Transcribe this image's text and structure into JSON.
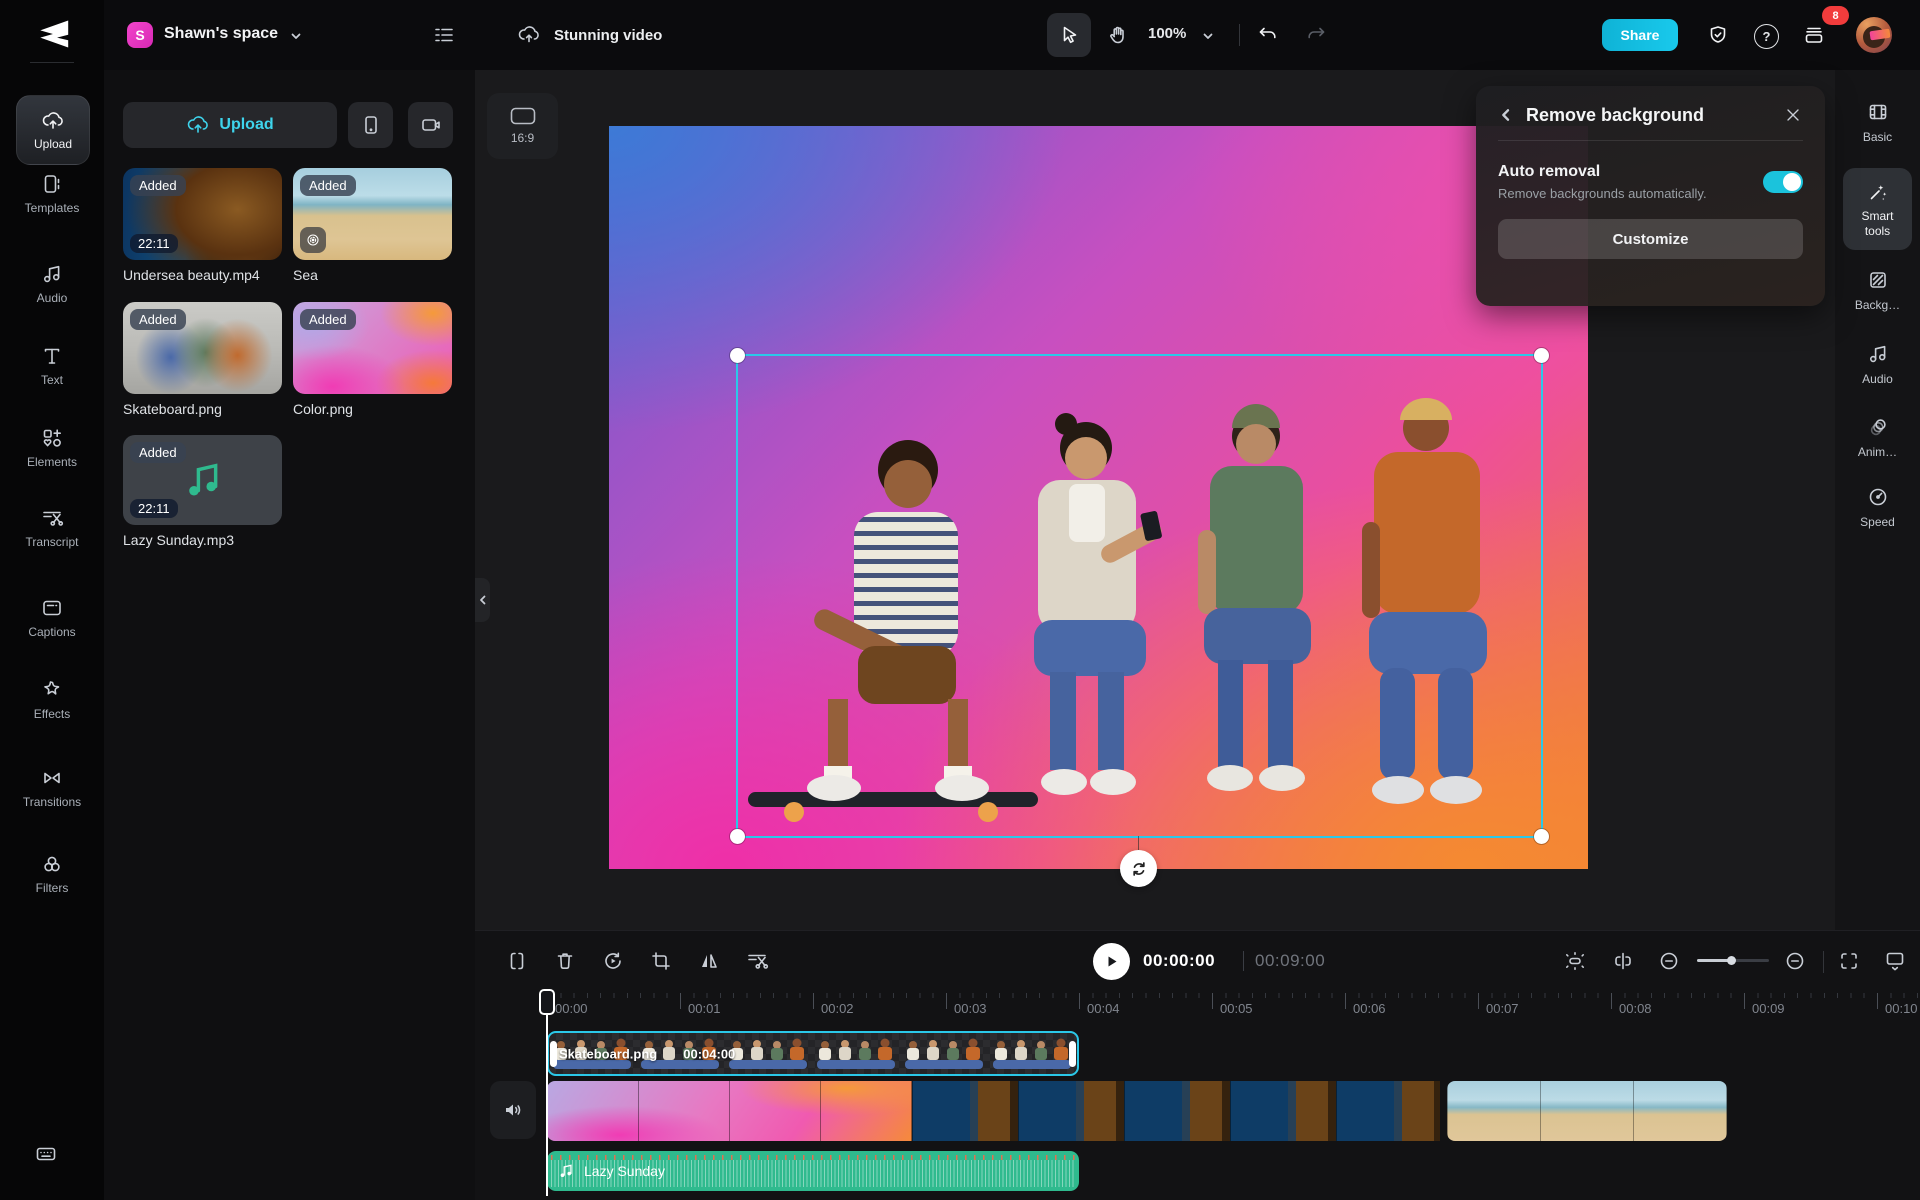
{
  "topbar": {
    "workspace_initial": "S",
    "workspace_name": "Shawn's space",
    "project_title": "Stunning video",
    "zoom_level": "100%",
    "share_label": "Share",
    "notification_count": "8",
    "help_glyph": "?"
  },
  "sidebar": {
    "items": [
      {
        "label": "Upload"
      },
      {
        "label": "Templates"
      },
      {
        "label": "Audio"
      },
      {
        "label": "Text"
      },
      {
        "label": "Elements"
      },
      {
        "label": "Transcript"
      },
      {
        "label": "Captions"
      },
      {
        "label": "Effects"
      },
      {
        "label": "Transitions"
      },
      {
        "label": "Filters"
      }
    ]
  },
  "media_panel": {
    "upload_label": "Upload",
    "items": [
      {
        "badge": "Added",
        "duration": "22:11",
        "name": "Undersea beauty.mp4"
      },
      {
        "badge": "Added",
        "name": "Sea"
      },
      {
        "badge": "Added",
        "name": "Skateboard.png"
      },
      {
        "badge": "Added",
        "name": "Color.png"
      },
      {
        "badge": "Added",
        "duration": "22:11",
        "name": "Lazy Sunday.mp3"
      }
    ]
  },
  "canvas": {
    "ratio_label": "16:9"
  },
  "popup": {
    "title": "Remove background",
    "auto_removal_label": "Auto removal",
    "auto_removal_desc": "Remove backgrounds automatically.",
    "toggle_state": "on",
    "customize_label": "Customize"
  },
  "right_sidebar": {
    "items": [
      {
        "label": "Basic"
      },
      {
        "label": "Smart tools"
      },
      {
        "label": "Backg…"
      },
      {
        "label": "Audio"
      },
      {
        "label": "Anim…"
      },
      {
        "label": "Speed"
      }
    ]
  },
  "timeline": {
    "current_time": "00:00:00",
    "total_time": "00:09:00",
    "ruler_labels": [
      "00:00",
      "00:01",
      "00:02",
      "00:03",
      "00:04",
      "00:05",
      "00:06",
      "00:07",
      "00:08",
      "00:09",
      "00:10"
    ],
    "overlay_clip": {
      "name": "Skateboard.png",
      "duration": "00:04:00"
    },
    "audio_clip": {
      "name": "Lazy Sunday"
    }
  }
}
